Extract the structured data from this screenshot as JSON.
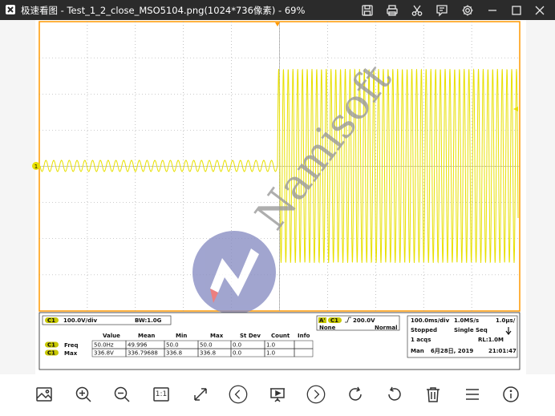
{
  "window": {
    "title": "极速看图 - Test_1_2_close_MSO5104.png(1024*736像素) - 69%"
  },
  "scope": {
    "channel_marker": "1",
    "ch1_label": "C1",
    "ch1_scale": "100.0V/div",
    "bandwidth": "BW:1.0G",
    "trigger_source_a": "A'",
    "trigger_level": "200.0V",
    "trigger_none": "None",
    "trigger_mode": "Normal",
    "timebase": "100.0ms/div",
    "sample_rate": "1.0MS/s",
    "sample_period": "1.0μs/",
    "state": "Stopped",
    "acq_mode": "Single Seq",
    "acqs": "1 acqs",
    "record_length": "RL:1.0M",
    "man": "Man",
    "date": "6月28日, 2019",
    "time": "21:01:47",
    "watermark": "Namisoft",
    "measurements": {
      "headers": [
        "Value",
        "Mean",
        "Min",
        "Max",
        "St Dev",
        "Count",
        "Info"
      ],
      "rows": [
        {
          "ch": "C1",
          "name": "Freq",
          "value": "50.0Hz",
          "mean": "49.996",
          "min": "50.0",
          "max": "50.0",
          "stdev": "0.0",
          "count": "1.0",
          "info": ""
        },
        {
          "ch": "C1",
          "name": "Max",
          "value": "336.8V",
          "mean": "336.79688",
          "min": "336.8",
          "max": "336.8",
          "stdev": "0.0",
          "count": "1.0",
          "info": ""
        }
      ]
    },
    "colors": {
      "trace": "#e8e000",
      "frame": "#ff9900",
      "grid": "#9a9a9a",
      "ch_badge": "#c8c800"
    }
  },
  "toolbar": {
    "one_to_one": "1:1"
  },
  "icons": [
    "image-icon",
    "zoom-in-icon",
    "zoom-out-icon",
    "actual-size-icon",
    "fit-screen-icon",
    "previous-icon",
    "slideshow-icon",
    "next-icon",
    "rotate-right-icon",
    "rotate-left-icon",
    "delete-icon",
    "menu-icon",
    "info-icon",
    "save-icon",
    "print-icon",
    "cut-icon",
    "edit-icon",
    "settings-icon",
    "minimize-icon",
    "maximize-icon",
    "close-icon"
  ]
}
